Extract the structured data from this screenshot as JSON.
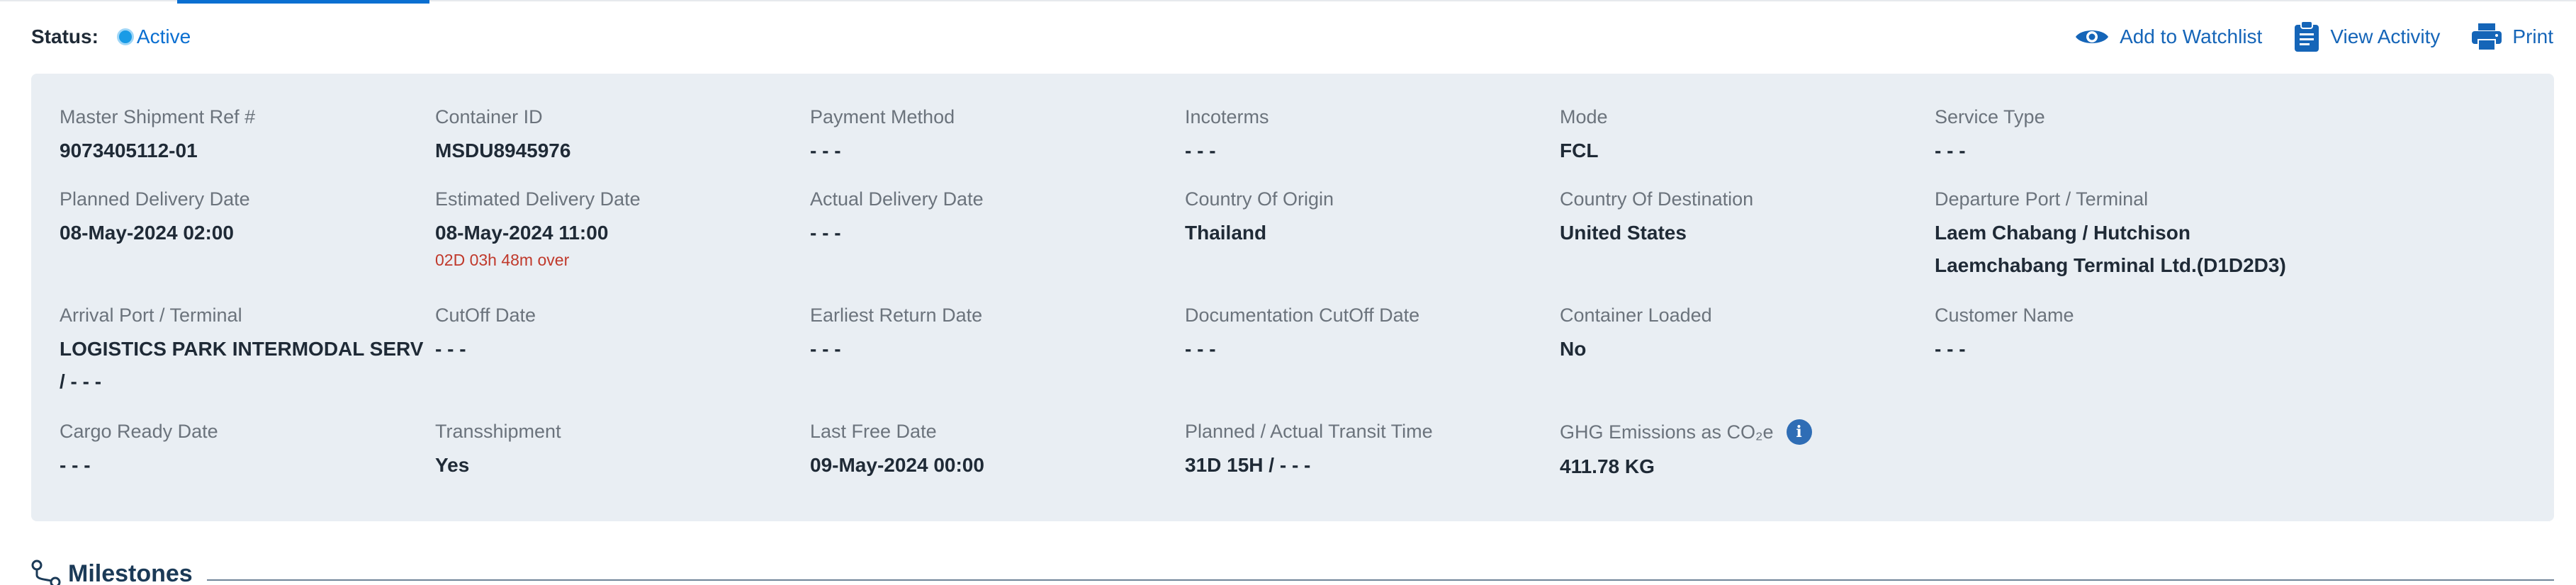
{
  "status": {
    "label": "Status:",
    "value": "Active"
  },
  "actions": {
    "watchlist": "Add to Watchlist",
    "activity": "View Activity",
    "print": "Print"
  },
  "fields": {
    "master_ref": {
      "label": "Master Shipment Ref #",
      "value": "9073405112-01"
    },
    "container_id": {
      "label": "Container ID",
      "value": "MSDU8945976"
    },
    "payment_method": {
      "label": "Payment Method",
      "value": "- - -"
    },
    "incoterms": {
      "label": "Incoterms",
      "value": "- - -"
    },
    "mode": {
      "label": "Mode",
      "value": "FCL"
    },
    "service_type": {
      "label": "Service Type",
      "value": "- - -"
    },
    "planned_delivery": {
      "label": "Planned Delivery Date",
      "value": "08-May-2024 02:00"
    },
    "estimated_delivery": {
      "label": "Estimated Delivery Date",
      "value": "08-May-2024 11:00",
      "note": "02D 03h 48m over"
    },
    "actual_delivery": {
      "label": "Actual Delivery Date",
      "value": "- - -"
    },
    "country_origin": {
      "label": "Country Of Origin",
      "value": "Thailand"
    },
    "country_destination": {
      "label": "Country Of Destination",
      "value": "United States"
    },
    "departure_port": {
      "label": "Departure Port / Terminal",
      "value": "Laem Chabang / Hutchison\nLaemchabang Terminal Ltd.(D1D2D3)"
    },
    "arrival_port": {
      "label": "Arrival Port / Terminal",
      "value": "LOGISTICS PARK INTERMODAL SERV\n/ - - -"
    },
    "cutoff_date": {
      "label": "CutOff Date",
      "value": "- - -"
    },
    "earliest_return": {
      "label": "Earliest Return Date",
      "value": "- - -"
    },
    "doc_cutoff": {
      "label": "Documentation CutOff Date",
      "value": "- - -"
    },
    "container_loaded": {
      "label": "Container Loaded",
      "value": "No"
    },
    "customer_name": {
      "label": "Customer Name",
      "value": "- - -"
    },
    "cargo_ready": {
      "label": "Cargo Ready Date",
      "value": "- - -"
    },
    "transshipment": {
      "label": "Transshipment",
      "value": "Yes"
    },
    "last_free": {
      "label": "Last Free Date",
      "value": "09-May-2024 00:00"
    },
    "transit_time": {
      "label": "Planned / Actual Transit Time",
      "value": "31D 15H / - - -"
    },
    "ghg": {
      "label": "GHG Emissions as CO₂e",
      "value": "411.78 KG",
      "info_icon": "i"
    }
  },
  "milestones": {
    "title": "Milestones",
    "icon": "route-icon"
  },
  "colors": {
    "accent": "#0a6fd1",
    "link": "#1565b8",
    "panel_bg": "#e9eef3",
    "overdue": "#c0392b",
    "status_active": "#1a9be6"
  }
}
